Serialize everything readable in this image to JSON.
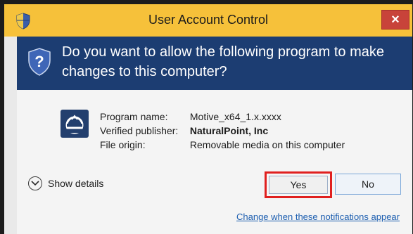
{
  "window": {
    "title": "User Account Control",
    "close_glyph": "×"
  },
  "header": {
    "question": "Do you want to allow the following program to make changes to this computer?"
  },
  "program": {
    "icon": "app-icon",
    "rows": [
      {
        "label": "Program name:",
        "value": "Motive_x64_1.x.xxxx",
        "bold": false
      },
      {
        "label": "Verified publisher:",
        "value": "NaturalPoint, Inc",
        "bold": true
      },
      {
        "label": "File origin:",
        "value": "Removable media on this computer",
        "bold": false
      }
    ]
  },
  "actions": {
    "show_details": "Show details",
    "yes": "Yes",
    "no": "No",
    "notification_link": "Change when these notifications appear"
  },
  "colors": {
    "titlebar": "#f6c13a",
    "header": "#1c3d72",
    "highlight": "#e0201f",
    "link": "#1e5fb0"
  }
}
